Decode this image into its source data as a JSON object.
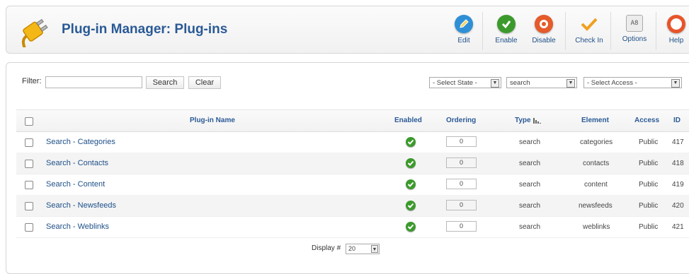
{
  "title": "Plug-in Manager: Plug-ins",
  "toolbar": {
    "edit": "Edit",
    "enable": "Enable",
    "disable": "Disable",
    "check_in": "Check In",
    "options": "Options",
    "help": "Help"
  },
  "colors": {
    "title": "#2a5a96",
    "edit": "#2f8fd6",
    "enable": "#3c9a2c",
    "disable": "#e55b2a",
    "check_in": "#f0a020",
    "help": "#e8542a"
  },
  "filter": {
    "label": "Filter:",
    "value": "",
    "search_label": "Search",
    "clear_label": "Clear"
  },
  "selects": {
    "state": "- Select State -",
    "type": "search",
    "access": "- Select Access -"
  },
  "columns": {
    "name": "Plug-in Name",
    "enabled": "Enabled",
    "ordering": "Ordering",
    "type": "Type",
    "element": "Element",
    "access": "Access",
    "id": "ID"
  },
  "rows": [
    {
      "name": "Search - Categories",
      "ordering": "0",
      "type": "search",
      "element": "categories",
      "access": "Public",
      "id": "417"
    },
    {
      "name": "Search - Contacts",
      "ordering": "0",
      "type": "search",
      "element": "contacts",
      "access": "Public",
      "id": "418"
    },
    {
      "name": "Search - Content",
      "ordering": "0",
      "type": "search",
      "element": "content",
      "access": "Public",
      "id": "419"
    },
    {
      "name": "Search - Newsfeeds",
      "ordering": "0",
      "type": "search",
      "element": "newsfeeds",
      "access": "Public",
      "id": "420"
    },
    {
      "name": "Search - Weblinks",
      "ordering": "0",
      "type": "search",
      "element": "weblinks",
      "access": "Public",
      "id": "421"
    }
  ],
  "footer": {
    "display_label": "Display #",
    "display_value": "20"
  }
}
